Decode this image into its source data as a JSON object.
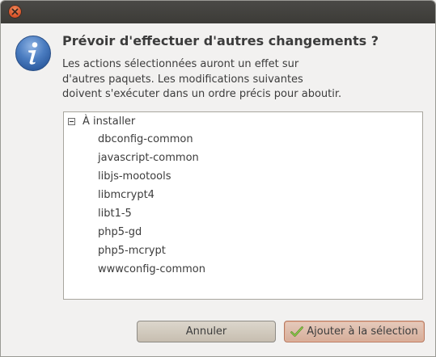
{
  "dialog": {
    "heading": "Prévoir d'effectuer d'autres changements ?",
    "description_lines": [
      "Les actions sélectionnées auront un effet sur",
      "d'autres paquets. Les modifications suivantes",
      "doivent s'exécuter dans un ordre précis pour aboutir."
    ]
  },
  "tree": {
    "group": {
      "label": "À installer",
      "expanded": true
    },
    "packages": [
      "dbconfig-common",
      "javascript-common",
      "libjs-mootools",
      "libmcrypt4",
      "libt1-5",
      "php5-gd",
      "php5-mcrypt",
      "wwwconfig-common"
    ]
  },
  "buttons": {
    "cancel": "Annuler",
    "confirm": "Ajouter à la sélection"
  },
  "icons": {
    "titlebar_close": "close-icon",
    "dialog": "info-icon",
    "confirm": "checkmark-icon"
  },
  "colors": {
    "titlebar": "#3c3b37",
    "close": "#d9542a",
    "info": "#3d6fb4",
    "confirm_button": "#d6ad99"
  }
}
